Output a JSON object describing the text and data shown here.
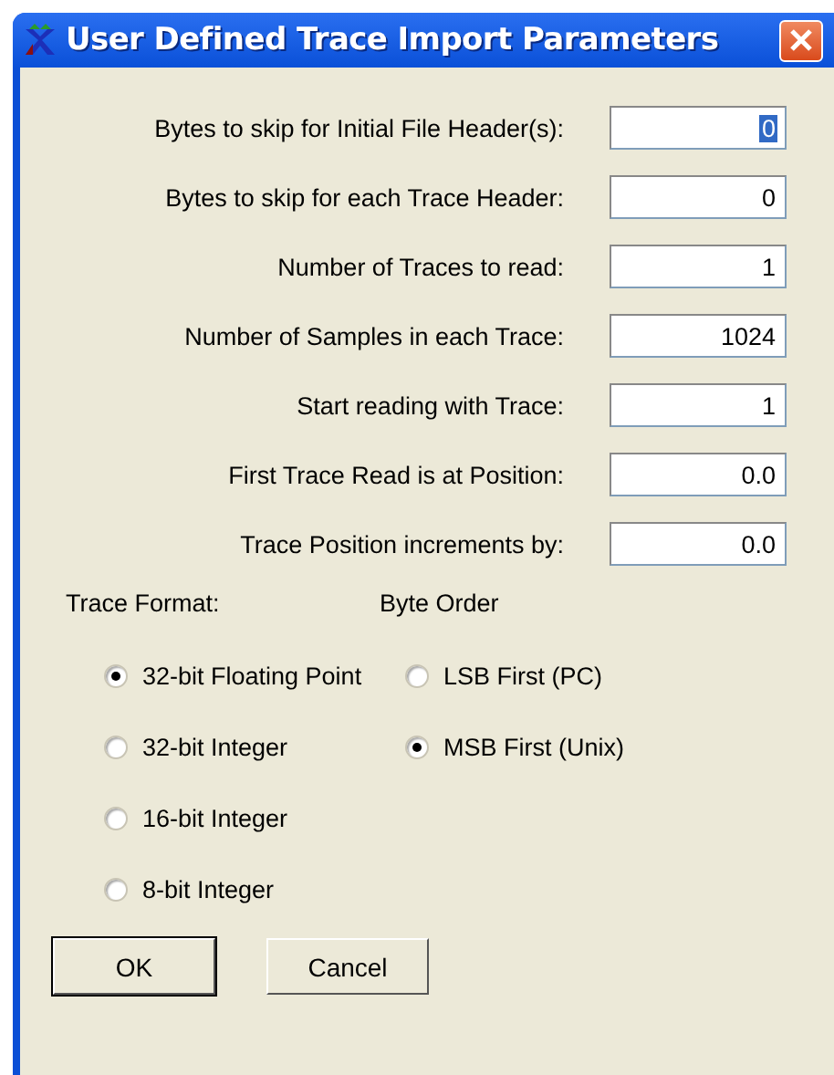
{
  "window": {
    "title": "User Defined Trace Import Parameters"
  },
  "fields": [
    {
      "label": "Bytes to skip for Initial File Header(s):",
      "value": "0",
      "text_selected": true
    },
    {
      "label": "Bytes to skip for each Trace Header:",
      "value": "0",
      "text_selected": false
    },
    {
      "label": "Number of Traces to read:",
      "value": "1",
      "text_selected": false
    },
    {
      "label": "Number of Samples in each Trace:",
      "value": "1024",
      "text_selected": false
    },
    {
      "label": "Start reading with Trace:",
      "value": "1",
      "text_selected": false
    },
    {
      "label": "First Trace Read is at Position:",
      "value": "0.0",
      "text_selected": false
    },
    {
      "label": "Trace Position increments by:",
      "value": "0.0",
      "text_selected": false
    }
  ],
  "trace_format": {
    "title": "Trace Format:",
    "options": [
      {
        "label": "32-bit Floating Point",
        "selected": true
      },
      {
        "label": "32-bit Integer",
        "selected": false
      },
      {
        "label": "16-bit Integer",
        "selected": false
      },
      {
        "label": "8-bit Integer",
        "selected": false
      }
    ]
  },
  "byte_order": {
    "title": "Byte Order",
    "options": [
      {
        "label": "LSB First (PC)",
        "selected": false
      },
      {
        "label": "MSB First (Unix)",
        "selected": true
      }
    ]
  },
  "buttons": [
    {
      "label": "OK",
      "default": true
    },
    {
      "label": "Cancel",
      "default": false
    }
  ]
}
